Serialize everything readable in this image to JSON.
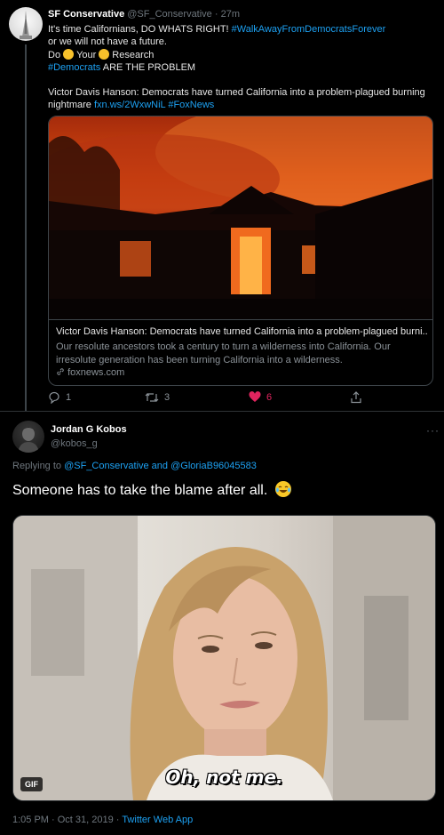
{
  "tweet": {
    "name": "SF Conservative",
    "handle": "@SF_Conservative",
    "time_sep": " · ",
    "time": "27m",
    "line1_text": "It's time Californians, DO WHATS RIGHT! ",
    "line1_tag": "#WalkAwayFromDemocratsForever",
    "line2": "or we will not have a future.",
    "line3_do": "Do",
    "line3_your": "Your",
    "line3_research": "Research",
    "line4_tag": "#Democrats",
    "line4_text": " ARE THE PROBLEM",
    "headline": "Victor Davis Hanson: Democrats have turned California into a problem-plagued burning",
    "headline2": "nightmare ",
    "link": "fxn.ws/2WxwNiL",
    "link_tag": " #FoxNews",
    "card": {
      "title": "Victor Davis Hanson: Democrats have turned California into a problem-plagued burni...",
      "description": "Our resolute ancestors took a century to turn a wilderness into California. Our irresolute generation has been turning California into a wilderness.",
      "domain": "foxnews.com"
    },
    "actions": {
      "replies": "1",
      "retweets": "3",
      "likes": "6",
      "reply_icon": "reply-icon",
      "retweet_icon": "retweet-icon",
      "like_icon": "heart-icon",
      "share_icon": "share-icon"
    }
  },
  "reply": {
    "name": "Jordan G Kobos",
    "handle": "@kobos_g",
    "more": "···",
    "replying_label": "Replying to ",
    "replying_users": "@SF_Conservative and @GloriaB96045583",
    "text": "Someone has to take the blame after all.",
    "gif_caption": "Oh, not me.",
    "gif_badge": "GIF",
    "meta_time": "1:05 PM · Oct 31, 2019 · ",
    "meta_app": "Twitter Web App"
  },
  "colors": {
    "background": "#000000",
    "link": "#1da1f2",
    "like": "#e0245e",
    "muted": "#6e767d"
  }
}
